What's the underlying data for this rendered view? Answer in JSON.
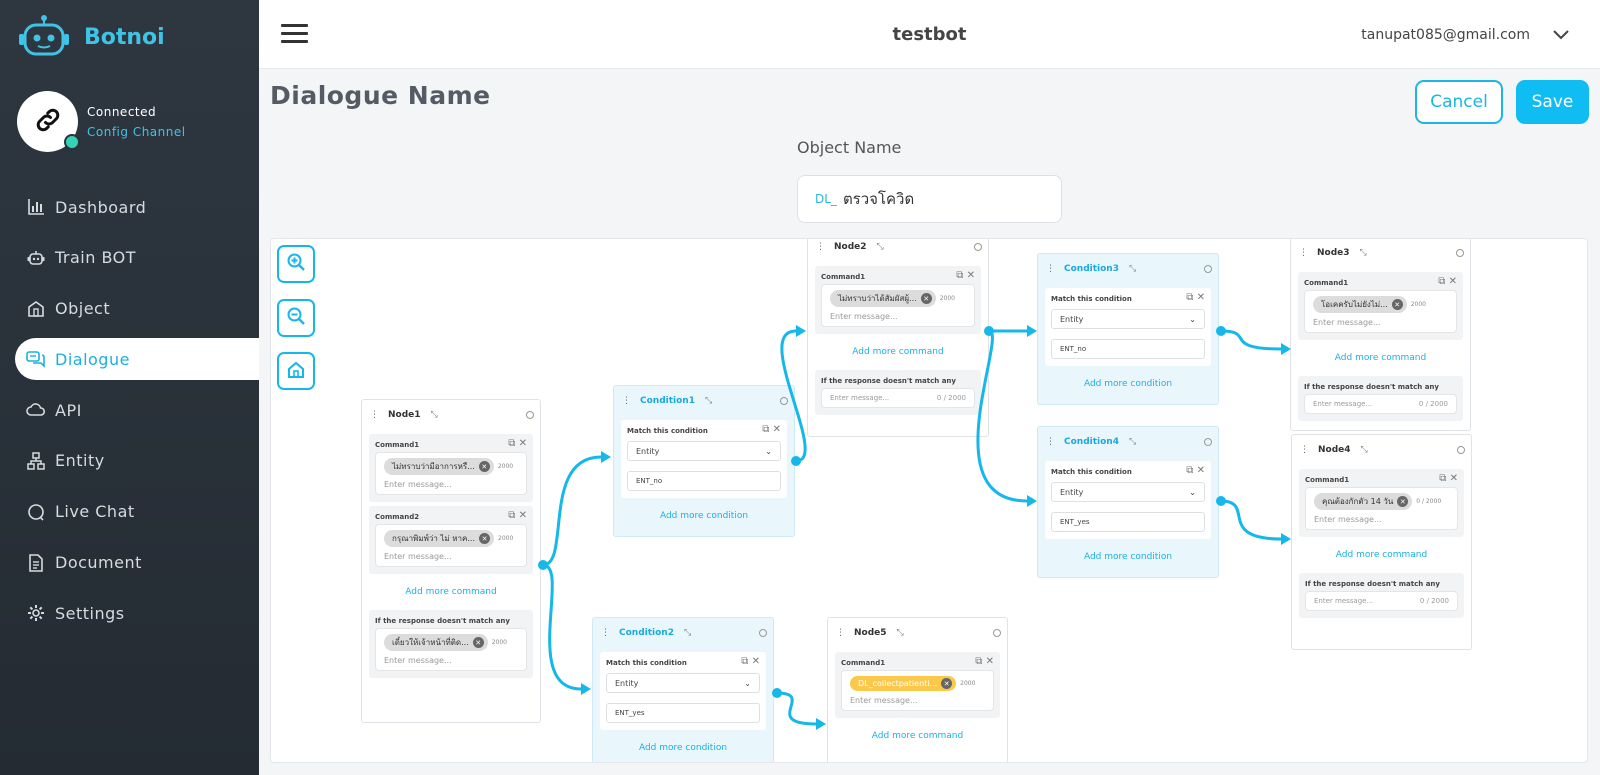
{
  "brand": {
    "name": "Botnoi"
  },
  "connection": {
    "status": "Connected",
    "link": "Config Channel"
  },
  "nav": [
    {
      "label": "Dashboard",
      "icon": "bar-chart-icon"
    },
    {
      "label": "Train BOT",
      "icon": "robot-icon"
    },
    {
      "label": "Object",
      "icon": "building-icon"
    },
    {
      "label": "Dialogue",
      "icon": "chat-bubbles-icon",
      "active": true
    },
    {
      "label": "API",
      "icon": "cloud-icon"
    },
    {
      "label": "Entity",
      "icon": "hierarchy-icon"
    },
    {
      "label": "Live Chat",
      "icon": "chat-bubble-icon"
    },
    {
      "label": "Document",
      "icon": "document-icon"
    },
    {
      "label": "Settings",
      "icon": "gear-icon"
    }
  ],
  "topbar": {
    "bot_name": "testbot",
    "user_email": "tanupat085@gmail.com"
  },
  "page": {
    "title": "Dialogue Name",
    "cancel_label": "Cancel",
    "save_label": "Save"
  },
  "object": {
    "label": "Object Name",
    "prefix": "DL_",
    "value": "ตรวจโควิด"
  },
  "flow": {
    "node1": {
      "title": "Node1",
      "commands": [
        {
          "label": "Command1",
          "chip": "ไม่ทราบว่ามีอาการหรื...",
          "count": "2000",
          "placeholder": "Enter message..."
        },
        {
          "label": "Command2",
          "chip": "กรุณาพิมพ์ว่า ไม่ หาค...",
          "count": "2000",
          "placeholder": "Enter message..."
        }
      ],
      "add_more": "Add more command",
      "nomatch": {
        "label": "If the response doesn't match any",
        "chip": "เดี๋ยวให้เจ้าหน้าที่ติด...",
        "count": "2000",
        "placeholder": "Enter message..."
      }
    },
    "condition1": {
      "title": "Condition1",
      "match_label": "Match this condition",
      "select": "Entity",
      "value": "ENT_no",
      "add_more": "Add more condition"
    },
    "condition2": {
      "title": "Condition2",
      "match_label": "Match this condition",
      "select": "Entity",
      "value": "ENT_yes",
      "add_more": "Add more condition"
    },
    "node2": {
      "title": "Node2",
      "command": {
        "label": "Command1",
        "chip": "ไม่ทราบว่าได้สัมผัสผู้...",
        "count": "2000",
        "placeholder": "Enter message..."
      },
      "add_more": "Add more command",
      "nomatch": {
        "label": "If the response doesn't match any",
        "placeholder": "Enter message...",
        "count": "0 / 2000"
      }
    },
    "condition3": {
      "title": "Condition3",
      "match_label": "Match this condition",
      "select": "Entity",
      "value": "ENT_no",
      "add_more": "Add more condition"
    },
    "condition4": {
      "title": "Condition4",
      "match_label": "Match this condition",
      "select": "Entity",
      "value": "ENT_yes",
      "add_more": "Add more condition"
    },
    "node3": {
      "title": "Node3",
      "command": {
        "label": "Command1",
        "chip": "โอเคครับไม่ยังไม่...",
        "count": "2000",
        "placeholder": "Enter message..."
      },
      "add_more": "Add more command",
      "nomatch": {
        "label": "If the response doesn't match any",
        "placeholder": "Enter message...",
        "count": "0 / 2000"
      }
    },
    "node4": {
      "title": "Node4",
      "command": {
        "label": "Command1",
        "chip": "คุณต้องกักตัว 14 วัน",
        "count": "0 / 2000",
        "placeholder": "Enter message..."
      },
      "add_more": "Add more command",
      "nomatch": {
        "label": "If the response doesn't match any",
        "placeholder": "Enter message...",
        "count": "0 / 2000"
      }
    },
    "node5": {
      "title": "Node5",
      "command": {
        "label": "Command1",
        "chip": "DL_collectpatienti...",
        "count": "2000",
        "placeholder": "Enter message..."
      },
      "add_more": "Add more command"
    }
  },
  "colors": {
    "accent": "#16b7e9",
    "sidebar": "#2a323b",
    "chip_yellow": "#fcc84a"
  }
}
